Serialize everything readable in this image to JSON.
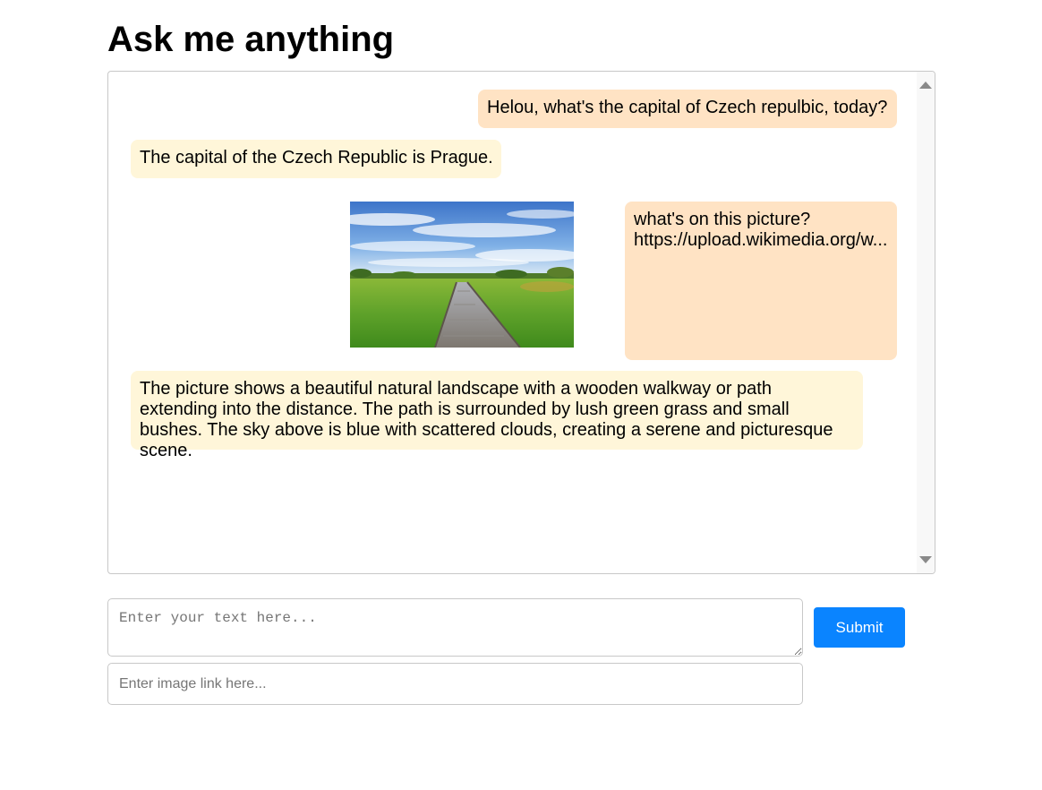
{
  "header": {
    "title": "Ask me anything"
  },
  "chat": {
    "messages": [
      {
        "role": "user",
        "text": "Helou, what's the capital of Czech repulbic, today?"
      },
      {
        "role": "assistant",
        "text": "The capital of the Czech Republic is Prague."
      },
      {
        "role": "user",
        "text": "what's on this picture?",
        "link": "https://upload.wikimedia.org/w...",
        "image": "landscape-boardwalk"
      },
      {
        "role": "assistant",
        "text": "The picture shows a beautiful natural landscape with a wooden walkway or path extending into the distance. The path is surrounded by lush green grass and small bushes. The sky above is blue with scattered clouds, creating a serene and picturesque scene."
      }
    ]
  },
  "form": {
    "text_placeholder": "Enter your text here...",
    "image_placeholder": "Enter image link here...",
    "submit_label": "Submit"
  },
  "colors": {
    "user_bubble": "#ffe3c4",
    "assistant_bubble": "#fff6d9",
    "submit_button": "#0a84ff"
  }
}
